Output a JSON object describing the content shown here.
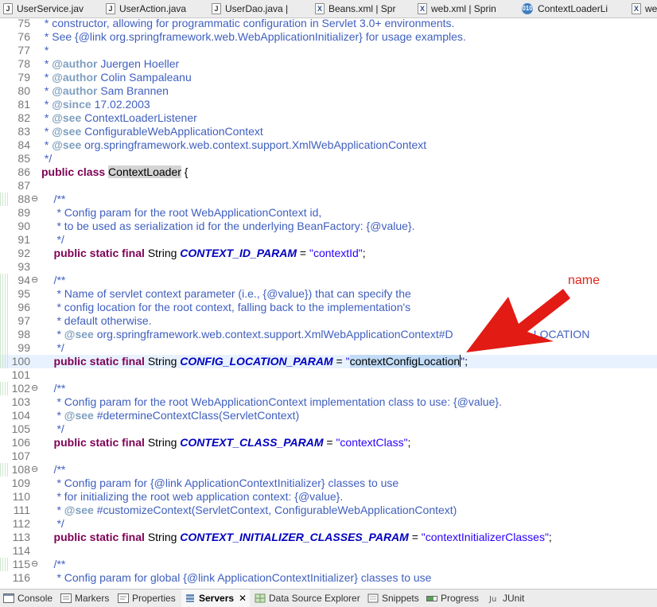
{
  "editor_tabs": [
    {
      "label": "UserService.jav",
      "icon": "java-file-icon"
    },
    {
      "label": "UserAction.java",
      "icon": "java-file-icon"
    },
    {
      "label": "UserDao.java |",
      "icon": "java-file-icon"
    },
    {
      "label": "Beans.xml | Spr",
      "icon": "xml-file-icon"
    },
    {
      "label": "web.xml | Sprin",
      "icon": "xml-file-icon"
    },
    {
      "label": "ContextLoaderLi",
      "icon": "class-file-icon"
    },
    {
      "label": "we",
      "icon": "xml-file-icon"
    }
  ],
  "code": {
    "current_line": "100",
    "lines": [
      {
        "n": "75",
        "fold": "",
        "parts": [
          [
            "cm",
            " * constructor, allowing for programmatic configuration in Servlet 3.0+ environments."
          ]
        ]
      },
      {
        "n": "76",
        "fold": "",
        "parts": [
          [
            "cm",
            " * See {@link org.springframework.web.WebApplicationInitializer} for usage examples."
          ]
        ]
      },
      {
        "n": "77",
        "fold": "",
        "parts": [
          [
            "cm",
            " *"
          ]
        ]
      },
      {
        "n": "78",
        "fold": "",
        "parts": [
          [
            "cm",
            " * "
          ],
          [
            "tag",
            "@author"
          ],
          [
            "cm",
            " Juergen Hoeller"
          ]
        ]
      },
      {
        "n": "79",
        "fold": "",
        "parts": [
          [
            "cm",
            " * "
          ],
          [
            "tag",
            "@author"
          ],
          [
            "cm",
            " Colin Sampaleanu"
          ]
        ]
      },
      {
        "n": "80",
        "fold": "",
        "parts": [
          [
            "cm",
            " * "
          ],
          [
            "tag",
            "@author"
          ],
          [
            "cm",
            " Sam Brannen"
          ]
        ]
      },
      {
        "n": "81",
        "fold": "",
        "parts": [
          [
            "cm",
            " * "
          ],
          [
            "tag",
            "@since"
          ],
          [
            "cm",
            " 17.02.2003"
          ]
        ]
      },
      {
        "n": "82",
        "fold": "",
        "parts": [
          [
            "cm",
            " * "
          ],
          [
            "tag",
            "@see"
          ],
          [
            "cm",
            " ContextLoaderListener"
          ]
        ]
      },
      {
        "n": "83",
        "fold": "",
        "parts": [
          [
            "cm",
            " * "
          ],
          [
            "tag",
            "@see"
          ],
          [
            "cm",
            " ConfigurableWebApplicationContext"
          ]
        ]
      },
      {
        "n": "84",
        "fold": "",
        "parts": [
          [
            "cm",
            " * "
          ],
          [
            "tag",
            "@see"
          ],
          [
            "cm",
            " org.springframework.web.context.support.XmlWebApplicationContext"
          ]
        ]
      },
      {
        "n": "85",
        "fold": "",
        "parts": [
          [
            "cm",
            " */"
          ]
        ]
      },
      {
        "n": "86",
        "fold": "",
        "parts": [
          [
            "kw",
            "public class "
          ],
          [
            "cls-hl",
            "ContextLoader"
          ],
          [
            "txt",
            " {"
          ]
        ]
      },
      {
        "n": "87",
        "fold": "",
        "parts": []
      },
      {
        "n": "88",
        "fold": "⊖",
        "parts": [
          [
            "cm",
            "    /**"
          ]
        ]
      },
      {
        "n": "89",
        "fold": "",
        "parts": [
          [
            "cm",
            "     * Config param for the root WebApplicationContext id,"
          ]
        ]
      },
      {
        "n": "90",
        "fold": "",
        "parts": [
          [
            "cm",
            "     * to be used as serialization id for the underlying BeanFactory: {@value}."
          ]
        ]
      },
      {
        "n": "91",
        "fold": "",
        "parts": [
          [
            "cm",
            "     */"
          ]
        ]
      },
      {
        "n": "92",
        "fold": "",
        "parts": [
          [
            "kw",
            "    public static final "
          ],
          [
            "txt",
            "String "
          ],
          [
            "fld",
            "CONTEXT_ID_PARAM"
          ],
          [
            "txt",
            " = "
          ],
          [
            "str",
            "\"contextId\""
          ],
          [
            "txt",
            ";"
          ]
        ]
      },
      {
        "n": "93",
        "fold": "",
        "parts": []
      },
      {
        "n": "94",
        "fold": "⊖",
        "parts": [
          [
            "cm",
            "    /**"
          ]
        ]
      },
      {
        "n": "95",
        "fold": "",
        "parts": [
          [
            "cm",
            "     * Name of servlet context parameter (i.e., {@value}) that can specify the"
          ]
        ]
      },
      {
        "n": "96",
        "fold": "",
        "parts": [
          [
            "cm",
            "     * config location for the root context, falling back to the implementation's"
          ]
        ]
      },
      {
        "n": "97",
        "fold": "",
        "parts": [
          [
            "cm",
            "     * default otherwise."
          ]
        ]
      },
      {
        "n": "98",
        "fold": "",
        "parts": [
          [
            "cm",
            "     * "
          ],
          [
            "tag",
            "@see"
          ],
          [
            "cm",
            " org.springframework.web.context.support.XmlWebApplicationContext#D          CONFIG_LOCATION"
          ]
        ]
      },
      {
        "n": "99",
        "fold": "",
        "parts": [
          [
            "cm",
            "     */"
          ]
        ]
      },
      {
        "n": "100",
        "fold": "",
        "parts": [
          [
            "kw",
            "    public static final "
          ],
          [
            "txt",
            "String "
          ],
          [
            "fld",
            "CONFIG_LOCATION_PARAM"
          ],
          [
            "txt",
            " = "
          ],
          [
            "str",
            "\""
          ],
          [
            "str-sel",
            "contextConfigLocation"
          ],
          [
            "caret",
            ""
          ],
          [
            "str",
            "\""
          ],
          [
            "txt",
            ";"
          ]
        ]
      },
      {
        "n": "101",
        "fold": "",
        "parts": []
      },
      {
        "n": "102",
        "fold": "⊖",
        "parts": [
          [
            "cm",
            "    /**"
          ]
        ]
      },
      {
        "n": "103",
        "fold": "",
        "parts": [
          [
            "cm",
            "     * Config param for the root WebApplicationContext implementation class to use: {@value}."
          ]
        ]
      },
      {
        "n": "104",
        "fold": "",
        "parts": [
          [
            "cm",
            "     * "
          ],
          [
            "tag",
            "@see"
          ],
          [
            "cm",
            " #determineContextClass(ServletContext)"
          ]
        ]
      },
      {
        "n": "105",
        "fold": "",
        "parts": [
          [
            "cm",
            "     */"
          ]
        ]
      },
      {
        "n": "106",
        "fold": "",
        "parts": [
          [
            "kw",
            "    public static final "
          ],
          [
            "txt",
            "String "
          ],
          [
            "fld",
            "CONTEXT_CLASS_PARAM"
          ],
          [
            "txt",
            " = "
          ],
          [
            "str",
            "\"contextClass\""
          ],
          [
            "txt",
            ";"
          ]
        ]
      },
      {
        "n": "107",
        "fold": "",
        "parts": []
      },
      {
        "n": "108",
        "fold": "⊖",
        "parts": [
          [
            "cm",
            "    /**"
          ]
        ]
      },
      {
        "n": "109",
        "fold": "",
        "parts": [
          [
            "cm",
            "     * Config param for {@link ApplicationContextInitializer} classes to use"
          ]
        ]
      },
      {
        "n": "110",
        "fold": "",
        "parts": [
          [
            "cm",
            "     * for initializing the root web application context: {@value}."
          ]
        ]
      },
      {
        "n": "111",
        "fold": "",
        "parts": [
          [
            "cm",
            "     * "
          ],
          [
            "tag",
            "@see"
          ],
          [
            "cm",
            " #customizeContext(ServletContext, ConfigurableWebApplicationContext)"
          ]
        ]
      },
      {
        "n": "112",
        "fold": "",
        "parts": [
          [
            "cm",
            "     */"
          ]
        ]
      },
      {
        "n": "113",
        "fold": "",
        "parts": [
          [
            "kw",
            "    public static final "
          ],
          [
            "txt",
            "String "
          ],
          [
            "fld",
            "CONTEXT_INITIALIZER_CLASSES_PARAM"
          ],
          [
            "txt",
            " = "
          ],
          [
            "str",
            "\"contextInitializerClasses\""
          ],
          [
            "txt",
            ";"
          ]
        ]
      },
      {
        "n": "114",
        "fold": "",
        "parts": []
      },
      {
        "n": "115",
        "fold": "⊖",
        "parts": [
          [
            "cm",
            "    /**"
          ]
        ]
      },
      {
        "n": "116",
        "fold": "",
        "parts": [
          [
            "cm",
            "     * Config param for global {@link ApplicationContextInitializer} classes to use"
          ]
        ]
      }
    ]
  },
  "annotation": {
    "label": "name",
    "color": "#e3241b"
  },
  "bottom_tabs": [
    {
      "label": "Console",
      "icon": "console-icon",
      "active": false
    },
    {
      "label": "Markers",
      "icon": "markers-icon",
      "active": false
    },
    {
      "label": "Properties",
      "icon": "properties-icon",
      "active": false
    },
    {
      "label": "Servers",
      "icon": "servers-icon",
      "active": true,
      "close": "✕"
    },
    {
      "label": "Data Source Explorer",
      "icon": "data-source-icon",
      "active": false
    },
    {
      "label": "Snippets",
      "icon": "snippets-icon",
      "active": false
    },
    {
      "label": "Progress",
      "icon": "progress-icon",
      "active": false
    },
    {
      "label": "JUnit",
      "icon": "junit-icon",
      "active": false
    }
  ]
}
